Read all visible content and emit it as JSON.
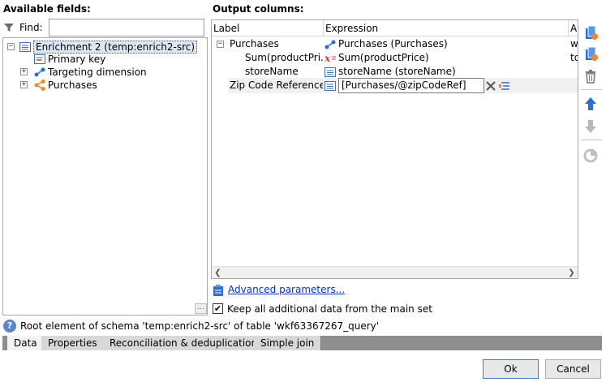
{
  "available_fields": {
    "title": "Available fields:",
    "find_label": "Find:",
    "find_value": "",
    "tree": [
      {
        "label": "Enrichment 2 (temp:enrich2-src)",
        "icon": "table-icon",
        "expander": "−"
      },
      {
        "label": "Primary key",
        "icon": "key-list-icon",
        "expander": ""
      },
      {
        "label": "Targeting dimension",
        "icon": "link-icon",
        "expander": "+"
      },
      {
        "label": "Purchases",
        "icon": "collection-icon",
        "expander": "+"
      }
    ],
    "more_button": "..."
  },
  "output_columns": {
    "title": "Output columns:",
    "headers": {
      "label": "Label",
      "expression": "Expression",
      "alias": "Al"
    },
    "rows": [
      {
        "label": "Purchases",
        "expression": "Purchases (Purchases)",
        "alias": "w",
        "expander": "−",
        "icon": "link-icon"
      },
      {
        "label": "Sum(productPri...",
        "expression": "Sum(productPrice)",
        "alias": "to",
        "icon": "formula-icon"
      },
      {
        "label": "storeName",
        "expression": "storeName (storeName)",
        "alias": "",
        "icon": "field-icon"
      },
      {
        "label": "Zip Code Reference...",
        "expression": "[Purchases/@zipCodeRef]",
        "alias": "",
        "icon": "field-icon"
      }
    ]
  },
  "advanced_link": "Advanced parameters...",
  "keep_data": {
    "checked": true,
    "label": "Keep all additional data from the main set"
  },
  "status": {
    "icon": "info-icon",
    "text": "Root element of schema 'temp:enrich2-src' of table 'wkf63367267_query'"
  },
  "tabs": [
    "Data",
    "Properties",
    "Reconciliation & deduplication",
    "Simple join"
  ],
  "active_tab": "Data",
  "buttons": {
    "ok": "Ok",
    "cancel": "Cancel"
  },
  "colors": {
    "accent": "#2a6fd6",
    "orange": "#f0862a",
    "link": "#0033cc"
  }
}
